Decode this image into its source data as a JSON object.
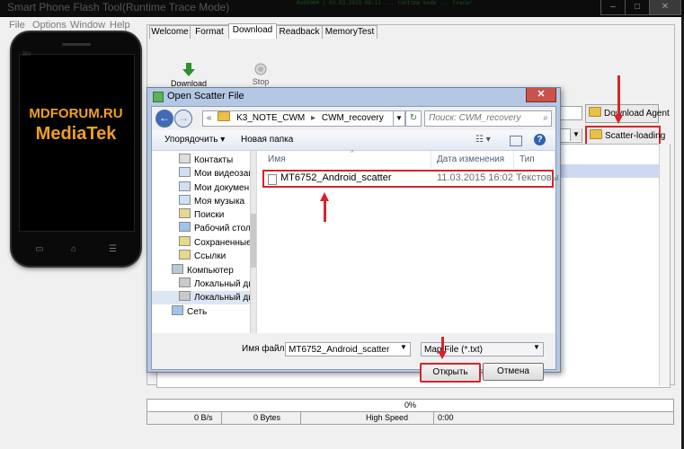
{
  "topbar": {
    "title": "Smart Phone Flash Tool(Runtime Trace Mode)",
    "matrix": "0x00000 | 03.03.2015 08:11  ...  runtime mode  ...  tracer"
  },
  "menu": [
    "File",
    "Options",
    "Window",
    "Help"
  ],
  "phone": {
    "brand_line1": "MDFORUM.RU",
    "brand_line2": "MediaTek",
    "bm": "BM"
  },
  "tool": {
    "tabs": [
      "Welcome",
      "Format",
      "Download",
      "Readback",
      "MemoryTest"
    ],
    "download_label": "Download",
    "stop_label": "Stop",
    "download_agent_label": "Download Agent",
    "scatter_loading_label": "Scatter-loading"
  },
  "status": {
    "progress": "0%",
    "progress_fraction": 0,
    "rate": "0 B/s",
    "bytes": "0 Bytes",
    "speed": "High Speed",
    "time": "0:00"
  },
  "dialog": {
    "title": "Open Scatter File",
    "close_glyph": "✕",
    "address": [
      "K3_NOTE_CWM",
      "CWM_recovery"
    ],
    "search_placeholder": "Поиск: CWM_recovery",
    "organize": "Упорядочить ▾",
    "new_folder": "Новая папка",
    "nav_items": [
      "Контакты",
      "Мои видеозап",
      "Мои докумен",
      "Моя музыка",
      "Поиски",
      "Рабочий стол",
      "Сохраненные",
      "Ссылки"
    ],
    "computer": "Компьютер",
    "drives": [
      "Локальный ди",
      "Локальный ди"
    ],
    "network": "Сеть",
    "columns": [
      "Имя",
      "Дата изменения",
      "Тип"
    ],
    "file": {
      "name": "MT6752_Android_scatter",
      "date": "11.03.2015 16:02",
      "type": "Текстовы"
    },
    "filename_label": "Имя файла:",
    "filename_value": "MT6752_Android_scatter",
    "filter": "Map File (*.txt)",
    "open_label": "Открыть",
    "cancel_label": "Отмена"
  },
  "colors": {
    "highlight": "#d7232a",
    "accent": "#f0a020",
    "dialog_frame": "#b4c8e4"
  }
}
